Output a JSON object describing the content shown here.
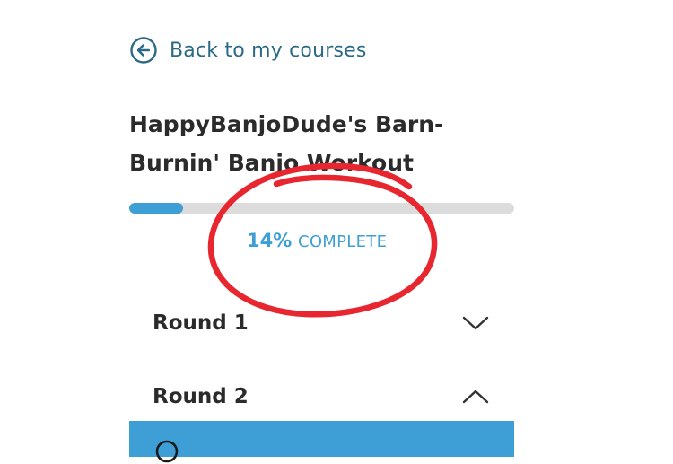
{
  "nav": {
    "back_label": "Back to my courses"
  },
  "course": {
    "title": "HappyBanjoDude's Barn-Burnin' Banjo Workout"
  },
  "progress": {
    "fraction": 0.14,
    "percent_label": "14%",
    "complete_label": "COMPLETE"
  },
  "sections": [
    {
      "title": "Round 1",
      "state": "collapsed",
      "icon": "chevron-down-icon"
    },
    {
      "title": "Round 2",
      "state": "expanded",
      "icon": "chevron-up-icon"
    }
  ],
  "colors": {
    "accent": "#3d9fd6",
    "back_link": "#2a6a86",
    "annotation": "#e8262f",
    "track": "#dcdcdc"
  }
}
